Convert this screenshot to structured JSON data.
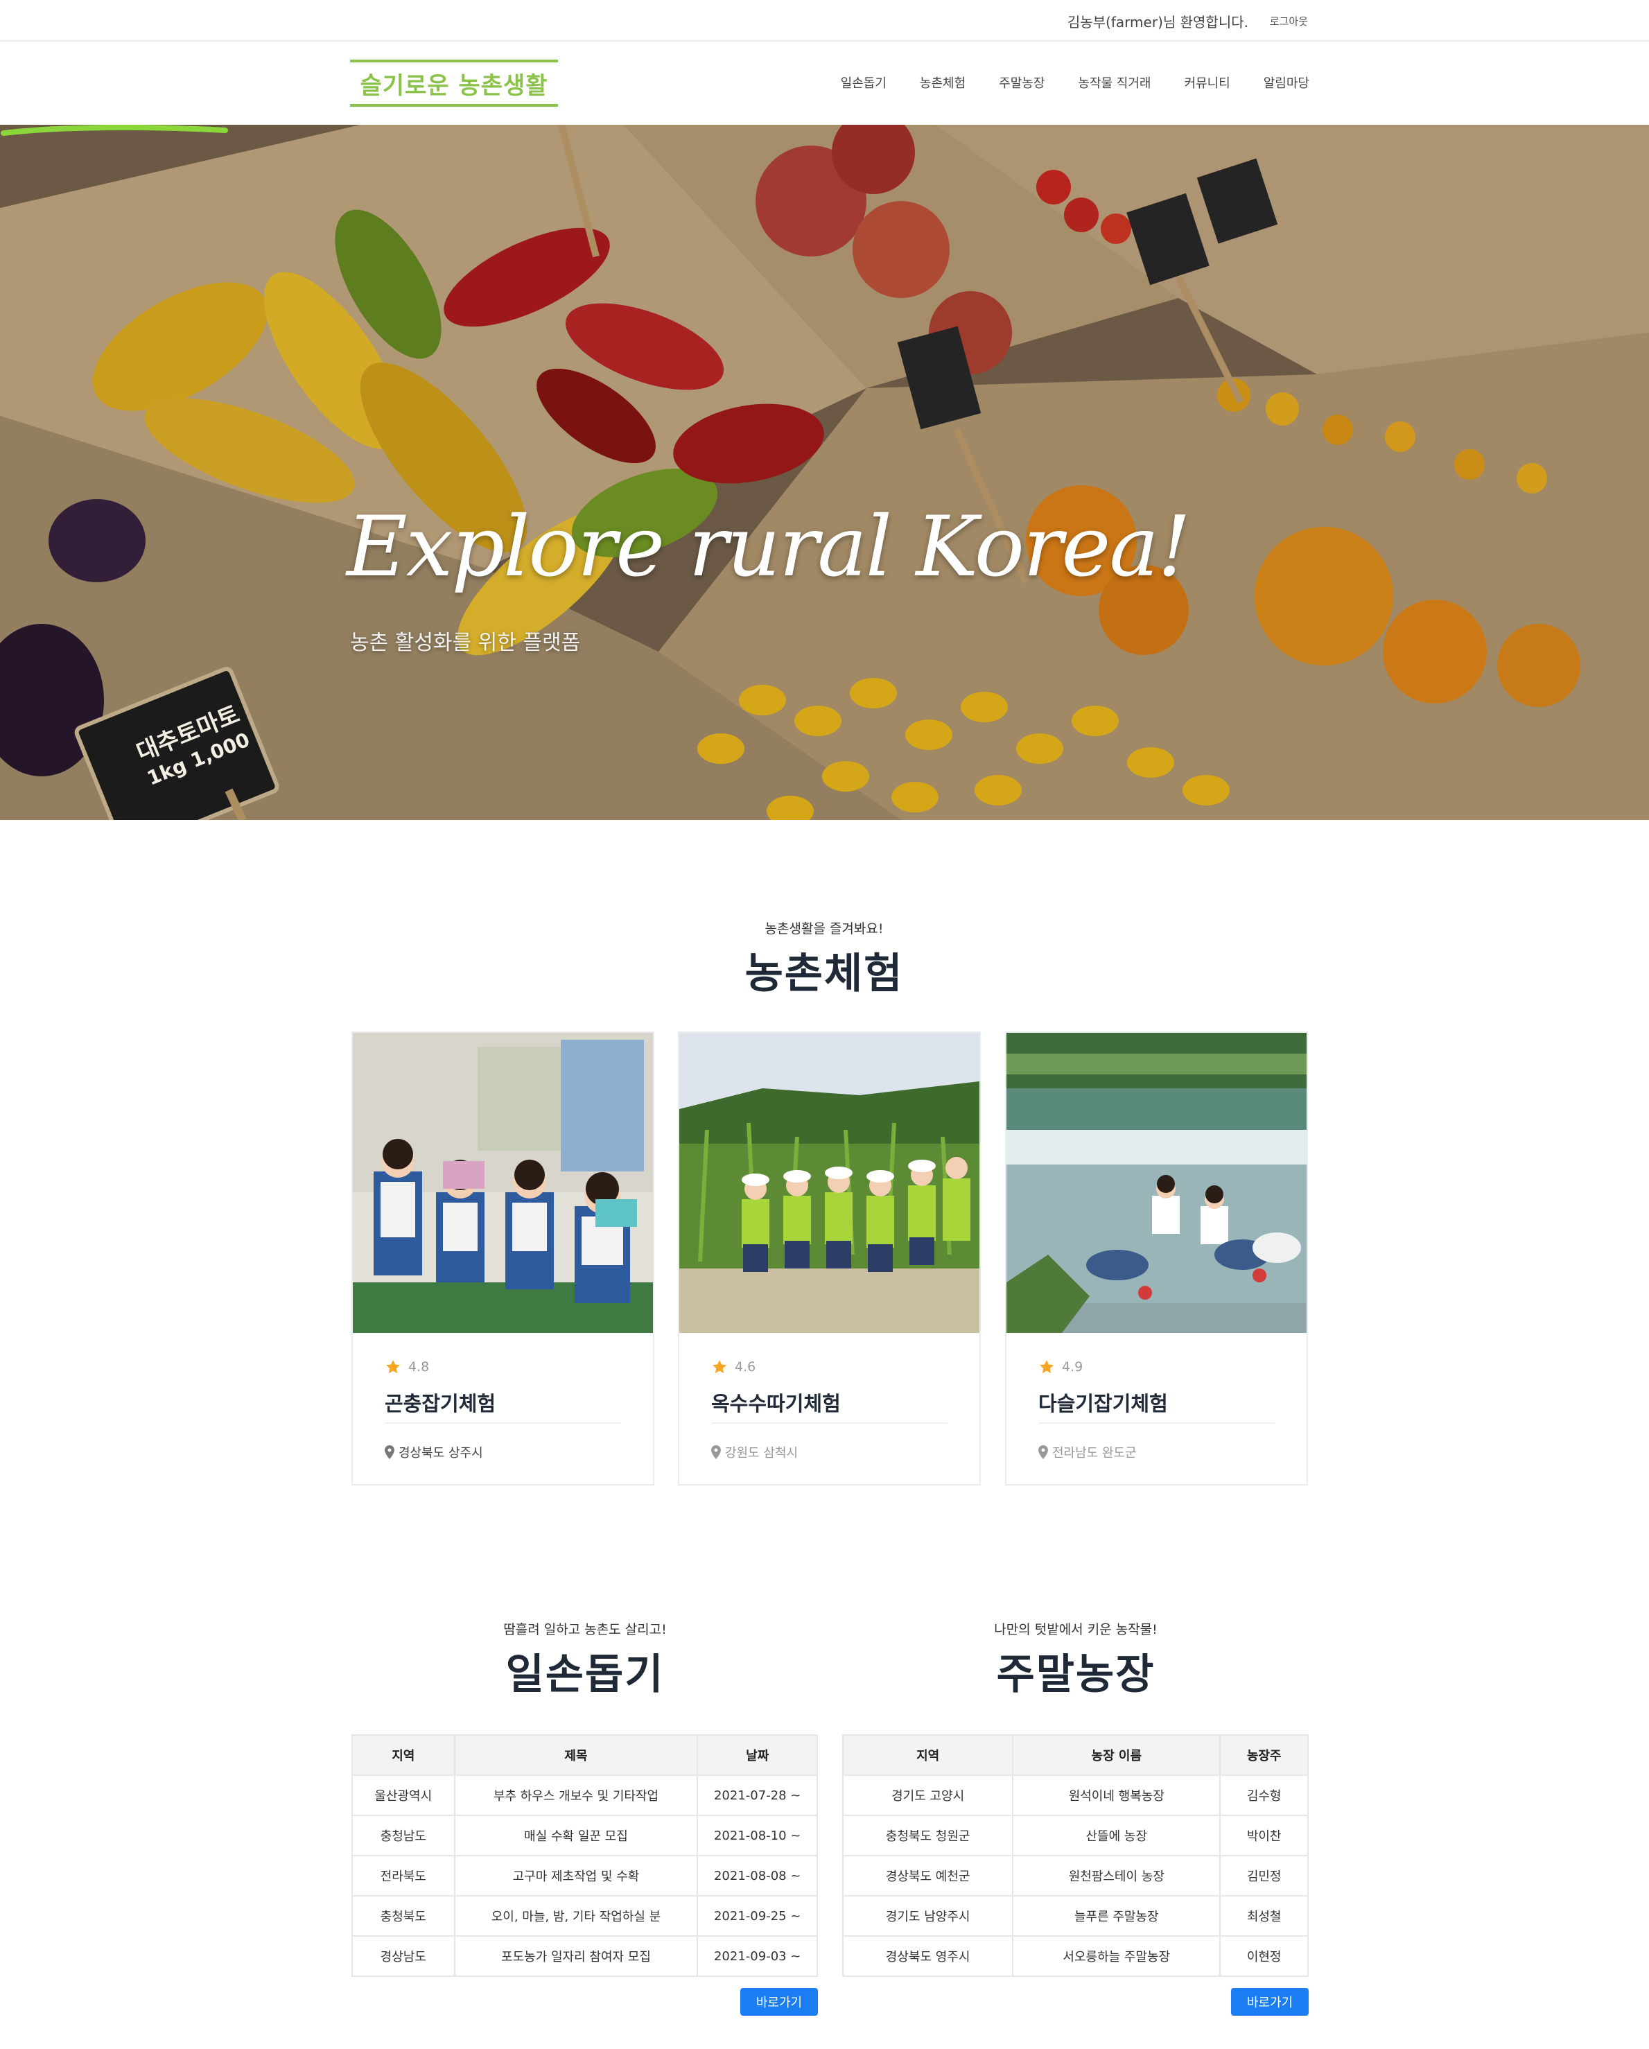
{
  "topbar": {
    "welcome": "김농부(farmer)님 환영합니다.",
    "logout": "로그아웃"
  },
  "header": {
    "logo": "슬기로운 농촌생활",
    "nav": [
      "일손돕기",
      "농촌체험",
      "주말농장",
      "농작물 직거래",
      "커뮤니티",
      "알림마당"
    ]
  },
  "hero": {
    "title": "Explore rural Korea!",
    "subtitle": "농촌 활성화를 위한 플랫폼",
    "sign_text_1": "대추토마토",
    "sign_text_2": "1kg 1,000"
  },
  "experience": {
    "kicker": "농촌생활을 즐겨봐요!",
    "title": "농촌체험",
    "cards": [
      {
        "rating": "4.8",
        "title": "곤충잡기체험",
        "location": "경상북도 상주시"
      },
      {
        "rating": "4.6",
        "title": "옥수수따기체험",
        "location": "강원도 삼척시"
      },
      {
        "rating": "4.9",
        "title": "다슬기잡기체험",
        "location": "전라남도 완도군"
      }
    ]
  },
  "help": {
    "kicker": "땀흘려 일하고 농촌도 살리고!",
    "title": "일손돕기",
    "columns": [
      "지역",
      "제목",
      "날짜"
    ],
    "rows": [
      [
        "울산광역시",
        "부추 하우스 개보수 및 기타작업",
        "2021-07-28 ~"
      ],
      [
        "충청남도",
        "매실 수확 일꾼 모집",
        "2021-08-10 ~"
      ],
      [
        "전라북도",
        "고구마 제초작업 및 수확",
        "2021-08-08 ~"
      ],
      [
        "충청북도",
        "오이, 마늘, 밤, 기타 작업하실 분",
        "2021-09-25 ~"
      ],
      [
        "경상남도",
        "포도농가 일자리 참여자 모집",
        "2021-09-03 ~"
      ]
    ],
    "button": "바로가기"
  },
  "weekend": {
    "kicker": "나만의 텃밭에서 키운 농작물!",
    "title": "주말농장",
    "columns": [
      "지역",
      "농장 이름",
      "농장주"
    ],
    "rows": [
      [
        "경기도 고양시",
        "원석이네 행복농장",
        "김수형"
      ],
      [
        "충청북도 청원군",
        "산뜰에 농장",
        "박이찬"
      ],
      [
        "경상북도 예천군",
        "원천팜스테이 농장",
        "김민정"
      ],
      [
        "경기도 남양주시",
        "늘푸른 주말농장",
        "최성철"
      ],
      [
        "경상북도 영주시",
        "서오릉하늘 주말농장",
        "이현정"
      ]
    ],
    "button": "바로가기"
  },
  "colors": {
    "brand_green": "#8bc34a",
    "button_blue": "#1a7df2",
    "star_gold": "#f5a623"
  }
}
